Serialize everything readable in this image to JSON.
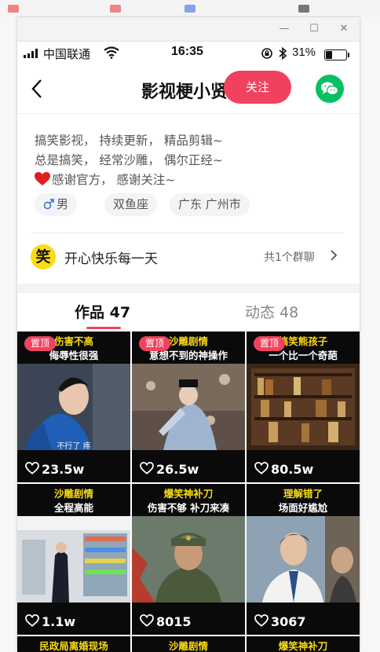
{
  "window": {
    "minimize_glyph": "—",
    "maximize_glyph": "☐",
    "close_glyph": "✕"
  },
  "status_bar": {
    "carrier": "中国联通",
    "time": "16:35",
    "battery": "31%",
    "battery_level": 0.31
  },
  "nav": {
    "title": "影视梗小贤",
    "follow_label": "关注",
    "back_icon": "chevron-left-icon",
    "share_icon": "wechat-icon"
  },
  "bio": {
    "lines": [
      "搞笑影视， 持续更新， 精品剪辑~",
      "总是搞笑， 经常沙雕， 偶尔正经~",
      "感谢官方， 感谢关注~"
    ],
    "line3_icon": "heart-icon"
  },
  "tags": [
    "男",
    "双鱼座",
    "广东 广州市"
  ],
  "tag_icons": {
    "gender": "male-icon"
  },
  "group": {
    "icon_text": "笑",
    "name": "开心快乐每一天",
    "count": "共1个群聊"
  },
  "tabs": [
    {
      "label": "作品 47",
      "active": true
    },
    {
      "label": "动态 48",
      "active": false
    }
  ],
  "colors": {
    "accent": "#f0425e",
    "wechat": "#07c160",
    "caption_yellow": "#fadb14"
  },
  "videos": [
    {
      "pinned": true,
      "pin_label": "置顶",
      "caption_top": "伤害不高",
      "caption_bottom": "侮辱性很强",
      "subtitle": "不行了 疼",
      "likes": "23.5w"
    },
    {
      "pinned": true,
      "pin_label": "置顶",
      "caption_top": "沙雕剧情",
      "caption_bottom": "意想不到的神操作",
      "subtitle": "",
      "likes": "26.5w"
    },
    {
      "pinned": true,
      "pin_label": "置顶",
      "caption_top": "搞笑熊孩子",
      "caption_bottom": "一个比一个奇葩",
      "subtitle": "",
      "likes": "80.5w"
    },
    {
      "pinned": false,
      "caption_top": "沙雕剧情",
      "caption_bottom": "全程高能",
      "subtitle": "",
      "likes": "1.1w"
    },
    {
      "pinned": false,
      "caption_top": "爆笑神补刀",
      "caption_bottom": "伤害不够 补刀来凑",
      "subtitle": "",
      "likes": "8015"
    },
    {
      "pinned": false,
      "caption_top": "理解错了",
      "caption_bottom": "场面好尴尬",
      "subtitle": "",
      "likes": "3067"
    },
    {
      "pinned": false,
      "caption_top": "民政局离婚现场",
      "caption_bottom": "",
      "subtitle": "",
      "likes": ""
    },
    {
      "pinned": false,
      "caption_top": "沙雕剧情",
      "caption_bottom": "",
      "subtitle": "",
      "likes": ""
    },
    {
      "pinned": false,
      "caption_top": "爆笑神补刀",
      "caption_bottom": "",
      "subtitle": "",
      "likes": ""
    }
  ]
}
